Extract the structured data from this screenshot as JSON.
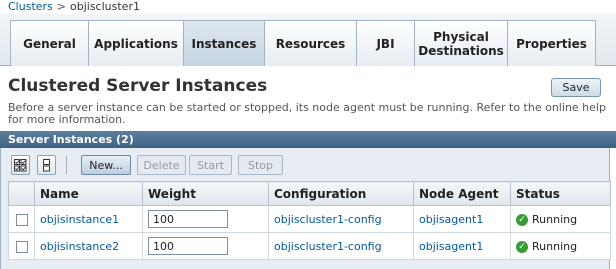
{
  "breadcrumb": {
    "parent": "Clusters",
    "separator": ">",
    "current": "objiscluster1"
  },
  "tabs": [
    {
      "label": "General"
    },
    {
      "label": "Applications"
    },
    {
      "label": "Instances"
    },
    {
      "label": "Resources"
    },
    {
      "label": "JBI"
    },
    {
      "label": "Physical Destinations"
    },
    {
      "label": "Properties"
    }
  ],
  "active_tab": "Instances",
  "page": {
    "title": "Clustered Server Instances",
    "save_label": "Save",
    "help_text": "Before a server instance can be started or stopped, its node agent must be running. Refer to the online help for more information."
  },
  "table": {
    "title": "Server Instances (2)",
    "actions": {
      "new": "New...",
      "delete": "Delete",
      "start": "Start",
      "stop": "Stop"
    },
    "columns": [
      "Name",
      "Weight",
      "Configuration",
      "Node Agent",
      "Status"
    ],
    "rows": [
      {
        "name": "objisinstance1",
        "weight": "100",
        "configuration": "objiscluster1-config",
        "node_agent": "objisagent1",
        "status": "Running"
      },
      {
        "name": "objisinstance2",
        "weight": "100",
        "configuration": "objiscluster1-config",
        "node_agent": "objisagent1",
        "status": "Running"
      }
    ]
  },
  "colors": {
    "link": "#035899",
    "header_bar": "#4b6e8f",
    "status_ok": "#3a9b34"
  },
  "icons": [
    "select-all-icon",
    "deselect-all-icon",
    "running-status-icon"
  ]
}
